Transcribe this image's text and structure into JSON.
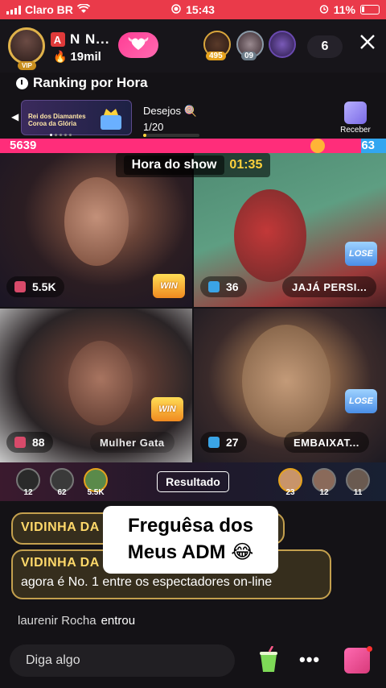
{
  "status_bar": {
    "carrier": "Claro BR",
    "time": "15:43",
    "battery": "11%"
  },
  "header": {
    "host_name": "N N...",
    "host_letter": "A",
    "host_likes": "19mil",
    "vip_label": "VIP",
    "viewers": [
      {
        "badge": "495",
        "badge_color": "#e5a21d"
      },
      {
        "badge": "09",
        "badge_color": "#8a9aa8"
      },
      {
        "badge": "",
        "badge_color": "#6a4ab0"
      }
    ],
    "viewer_count": "6"
  },
  "ranking": {
    "label": "Ranking por Hora"
  },
  "event_banner": {
    "line1": "Rei dos Diamantes",
    "line2": "Coroa da Glória"
  },
  "wish": {
    "label": "Desejos",
    "progress": "1/20",
    "progress_fraction": 0.05
  },
  "receber": {
    "label": "Receber"
  },
  "pk": {
    "left_score": "5639",
    "right_score": "63",
    "left_color": "#ff2d7a",
    "right_color": "#32a6f0"
  },
  "show": {
    "label": "Hora do show",
    "timer": "01:35"
  },
  "tiles": [
    {
      "score": "5.5K",
      "result": "WIN",
      "name": ""
    },
    {
      "score": "36",
      "result": "LOSE",
      "name": "JAJÁ PERSI..."
    },
    {
      "score": "88",
      "result": "WIN",
      "name": "Mulher Gata"
    },
    {
      "score": "27",
      "result": "LOSE",
      "name": "EMBAIXAT..."
    }
  ],
  "strip": {
    "left": [
      "12",
      "62",
      "5.5K"
    ],
    "right": [
      "23",
      "12",
      "11"
    ],
    "result_button": "Resultado"
  },
  "chat": {
    "messages": [
      {
        "name": "VIDINHA DA",
        "text": ""
      },
      {
        "name": "VIDINHA DA",
        "text": "agora é No. 1 entre os espectadores on-line"
      }
    ],
    "caption_line1": "Freguêsa dos",
    "caption_line2": "Meus ADM 😂",
    "join_user": "laurenir Rocha",
    "join_action": "entrou"
  },
  "bottom": {
    "input_placeholder": "Diga algo",
    "more": "•••"
  }
}
